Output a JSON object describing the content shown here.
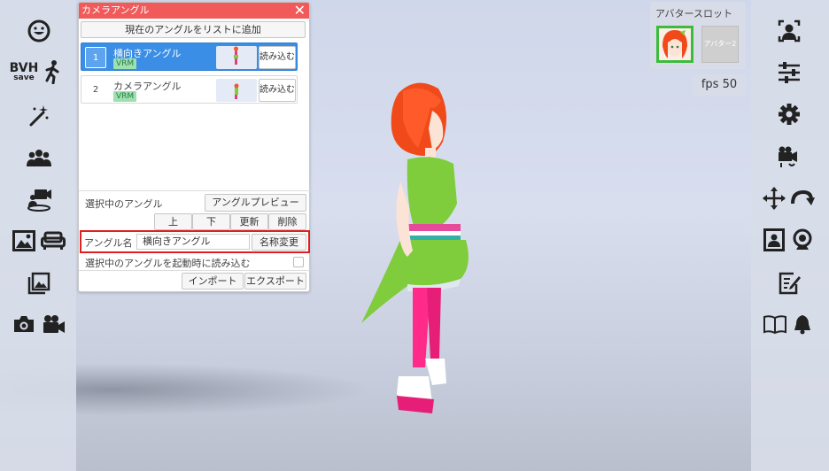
{
  "panel": {
    "title": "カメラアングル",
    "close_label": "✕",
    "add_button": "現在のアングルをリストに追加",
    "items": [
      {
        "num": "1",
        "name": "横向きアングル",
        "badge": "VRM",
        "load": "読み込む"
      },
      {
        "num": "2",
        "name": "カメラアングル",
        "badge": "VRM",
        "load": "読み込む"
      }
    ],
    "selected_label": "選択中のアングル",
    "preview_button": "アングルプレビュー",
    "up_button": "上",
    "down_button": "下",
    "update_button": "更新",
    "delete_button": "削除",
    "angle_name_label": "アングル名",
    "angle_name_value": "横向きアングル",
    "rename_button": "名称変更",
    "load_on_start_label": "選択中のアングルを起動時に読み込む",
    "import_button": "インポート",
    "export_button": "エクスポート"
  },
  "avatar_slot": {
    "title": "アバタースロット",
    "slot2_label": "アバター2"
  },
  "fps": {
    "label": "fps",
    "value": "50"
  },
  "left_toolbar": {
    "bvh_label": "BVH",
    "bvh_sub": "save",
    "icons": [
      "face-icon",
      "bvh-save-icon",
      "walk-icon",
      "magic-wand-icon",
      "group-icon",
      "camera-person-icon",
      "image-icon",
      "sofa-icon",
      "photo-frame-icon",
      "camera-icon",
      "video-camera-icon"
    ]
  },
  "right_toolbar": {
    "icons": [
      "person-frame-icon",
      "sliders-icon",
      "gear-icon",
      "video-camera-rotate-icon",
      "move-icon",
      "rotate-icon",
      "portrait-icon",
      "webcam-icon",
      "edit-icon",
      "book-icon",
      "bell-icon"
    ]
  },
  "colors": {
    "title_bar": "#f05a5a",
    "selected_item": "#3a8ee6",
    "highlight_border": "#e02020",
    "avatar_selected_border": "#3dbb3d"
  }
}
